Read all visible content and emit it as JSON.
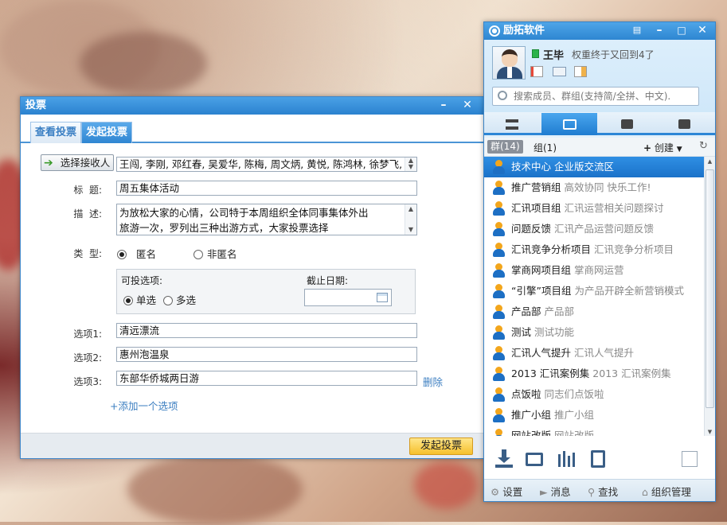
{
  "vote_window": {
    "title": "投票",
    "tabs": [
      {
        "label": "查看投票"
      },
      {
        "label": "发起投票"
      }
    ],
    "select_recipients_label": "选择接收人",
    "recipients": "王闯, 李刚, 邓红春, 吴爱华, 陈梅, 周文炳, 黄悦, 陈鸿林, 徐梦飞, 汪永",
    "title_label": "标  题:",
    "title_value": "周五集体活动",
    "desc_label": "描  述:",
    "desc_line1": "为放松大家的心情，公司特于本周组织全体同事集体外出",
    "desc_line2": "旅游一次，罗列出三种出游方式，大家投票选择",
    "type_label": "类  型:",
    "type_anonymous": "匿名",
    "type_named": "非匿名",
    "votable_label": "可投选项:",
    "single_label": "单选",
    "multi_label": "多选",
    "deadline_label": "截止日期:",
    "option1_label": "选项1:",
    "option1_value": "清远漂流",
    "option2_label": "选项2:",
    "option2_value": "惠州泡温泉",
    "option3_label": "选项3:",
    "option3_value": "东部华侨城两日游",
    "delete_label": "删除",
    "add_option_label": "+添加一个选项",
    "submit_label": "发起投票"
  },
  "im": {
    "app_title": "励拓软件",
    "user_name": "王毕",
    "user_signature": "权重终于又回到4了",
    "search_placeholder": "搜索成员、群组(支持简/全拼、中文).",
    "groups_tab": "群(14)",
    "group_tab": "组(1)",
    "create_label": "创建",
    "groups": [
      {
        "name": "技术中心",
        "desc": "企业版交流区"
      },
      {
        "name": "推广营销组",
        "desc": "高效协同 快乐工作!"
      },
      {
        "name": "汇讯项目组",
        "desc": "汇讯运营相关问题探讨"
      },
      {
        "name": "问题反馈",
        "desc": "汇讯产品运营问题反馈"
      },
      {
        "name": "汇讯竞争分析项目",
        "desc": "汇讯竞争分析项目"
      },
      {
        "name": "掌商网项目组",
        "desc": "掌商网运营"
      },
      {
        "name": "“引擎”项目组",
        "desc": "为产品开辟全新营销模式"
      },
      {
        "name": "产品部",
        "desc": "产品部"
      },
      {
        "name": "测试",
        "desc": "测试功能"
      },
      {
        "name": "汇讯人气提升",
        "desc": "汇讯人气提升"
      },
      {
        "name": "2013 汇讯案例集",
        "desc": "2013 汇讯案例集"
      },
      {
        "name": "点饭啦",
        "desc": "同志们点饭啦"
      },
      {
        "name": "推广小组",
        "desc": "推广小组"
      },
      {
        "name": "网站改版",
        "desc": "网站改版"
      }
    ],
    "bottom": {
      "settings": "设置",
      "messages": "消息",
      "find": "查找",
      "org": "组织管理"
    },
    "colors": {
      "accent": "#2d86d6",
      "selected": "#1b72c9",
      "online": "#2bb34a"
    }
  }
}
